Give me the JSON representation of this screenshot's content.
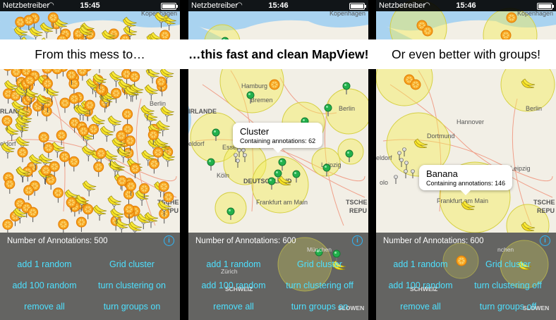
{
  "status_bar": {
    "carrier": "Netzbetreiber",
    "screens": [
      {
        "time": "15:45"
      },
      {
        "time": "15:46"
      },
      {
        "time": "15:46"
      }
    ]
  },
  "banner": {
    "left": "From this mess to…",
    "middle": "…this fast and clean MapView!",
    "right": "Or even better with groups!"
  },
  "map_labels": {
    "kopenhagen": "Kopenhagen",
    "hamburg": "Hamburg",
    "bremen": "Bremen",
    "berlin": "Berlin",
    "hannover": "Hannover",
    "irlande": "IRLANDE",
    "essen": "Essen",
    "koeln": "Köln",
    "deutschland": "DEUTSCHLAND",
    "leipzig": "Leipzig",
    "frankfurt": "Frankfurt am Main",
    "tsche": "TSCHE",
    "repu": "REPU",
    "muenchen": "München",
    "zuerich": "Zürich",
    "schweiz": "SCHWEIZ",
    "sloven": "SLOWEN",
    "dortmund": "Dortmund",
    "eldorf": "eldorf",
    "rland": "RLAND",
    "olo": "olo",
    "nchen": "nchen"
  },
  "callouts": {
    "cluster": {
      "title": "Cluster",
      "subtitle": "Containing annotations: 62"
    },
    "banana": {
      "title": "Banana",
      "subtitle": "Containing annotations: 146"
    }
  },
  "controls": [
    {
      "count": "Number of Annotations: 500",
      "buttons": {
        "add1": "add 1 random",
        "add100": "add 100 random",
        "remove": "remove all",
        "grid": "Grid cluster",
        "clustering": "turn clustering on",
        "groups": "turn groups on"
      }
    },
    {
      "count": "Number of Annotations: 600",
      "buttons": {
        "add1": "add 1 random",
        "add100": "add 100 random",
        "remove": "remove all",
        "grid": "Grid cluster",
        "clustering": "turn clustering off",
        "groups": "turn groups on"
      }
    },
    {
      "count": "Number of Annotations: 600",
      "buttons": {
        "add1": "add 1 random",
        "add100": "add 100 random",
        "remove": "remove all",
        "grid": "Grid cluster",
        "clustering": "turn clustering off",
        "groups": "turn groups off"
      }
    }
  ],
  "colors": {
    "cluster_fill": "#f3ee57",
    "cluster_stroke": "#d6d044",
    "pin_green": "#22b14c",
    "button_text": "#4de0ff",
    "info": "#2fb6f7"
  },
  "icons": {
    "annotation_orange": "orange-icon",
    "annotation_banana": "banana-icon",
    "annotation_pin": "green-pin-icon"
  }
}
